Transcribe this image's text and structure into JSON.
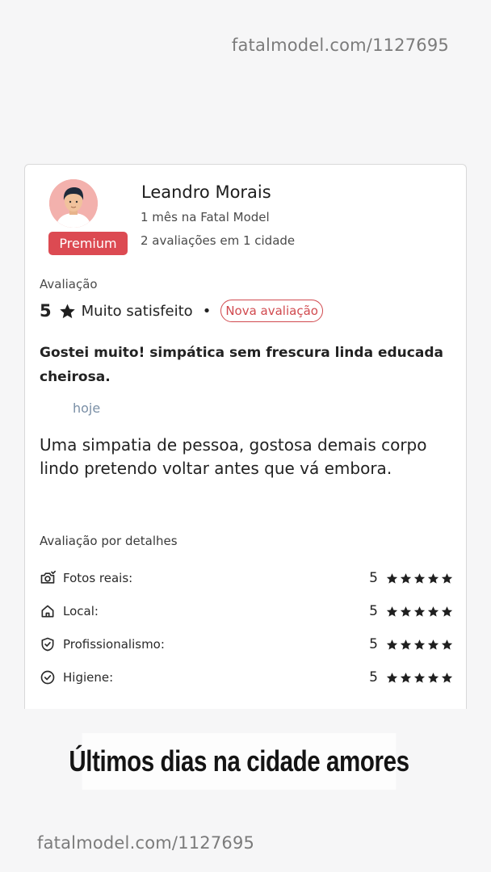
{
  "watermark_top": "fatalmodel.com/1127695",
  "watermark_bottom": "fatalmodel.com/1127695",
  "reviewer": {
    "name": "Leandro Morais",
    "member_since": "1 mês na Fatal Model",
    "reviews_summary": "2 avaliações em 1 cidade",
    "badge": "Premium",
    "avatar_icon": "man-avatar-icon"
  },
  "rating": {
    "caption": "Avaliação",
    "score": "5",
    "label": "Muito satisfeito",
    "separator": "•",
    "new_badge": "Nova avaliação"
  },
  "review": {
    "headline": "Gostei muito! simpática sem frescura linda educada cheirosa.",
    "when": "hoje",
    "comment": "Uma simpatia de pessoa, gostosa demais corpo lindo pretendo voltar antes que vá embora."
  },
  "details": {
    "title": "Avaliação por detalhes",
    "items": [
      {
        "label": "Fotos reais:",
        "score": "5",
        "stars": 5,
        "icon": "camera-check-icon"
      },
      {
        "label": "Local:",
        "score": "5",
        "stars": 5,
        "icon": "home-icon"
      },
      {
        "label": "Profissionalismo:",
        "score": "5",
        "stars": 5,
        "icon": "shield-check-icon"
      },
      {
        "label": "Higiene:",
        "score": "5",
        "stars": 5,
        "icon": "circle-check-icon"
      }
    ]
  },
  "banner_text": "Últimos dias na cidade amores",
  "colors": {
    "accent_red": "#dc4a52",
    "avatar_bg": "#f3b1ad",
    "timestamp": "#7a8fa6"
  }
}
